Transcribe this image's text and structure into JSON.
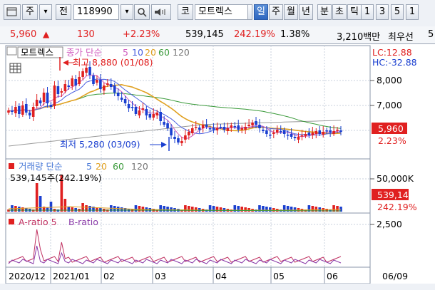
{
  "toolbar": {
    "market_button": "주",
    "dropdown_arrow": "▾",
    "prev_button": "전",
    "stock_code": "118990",
    "code_button": "코",
    "stock_name": "모트렉스",
    "period_buttons": [
      "일",
      "주",
      "월",
      "년",
      "분",
      "초",
      "틱"
    ],
    "selected_period": "일",
    "interval_buttons": [
      "1",
      "3",
      "5",
      "1"
    ],
    "icons": [
      "chart-menu-icon",
      "search-icon",
      "speaker-icon"
    ]
  },
  "quote": {
    "price": "5,960",
    "change_arrow": "▲",
    "change": "130",
    "change_pct": "+2.23%",
    "volume": "539,145",
    "volume_ratio": "242.19%",
    "turnover_rate": "1.38%",
    "amount": "3,210백만",
    "preferred_label": "최우선",
    "partial": "5"
  },
  "price_panel": {
    "legend_name": "모트렉스",
    "legend_ma": "종가 단순",
    "ma_periods": [
      "5",
      "10",
      "20",
      "60",
      "120"
    ],
    "ma_colors": [
      "#d05ec0",
      "#4a5fe0",
      "#e0a020",
      "#3a9a3a",
      "#9a9a9a"
    ],
    "high_label": "최고 8,880 (01/08)",
    "low_label": "최저 5,280 (03/09)",
    "lc_label": "LC:12.88",
    "hc_label": "HC:-32.88",
    "price_ticks": [
      "8,000",
      "7,000",
      "6,000"
    ],
    "current_price": "5,960",
    "current_pct": "2.23%"
  },
  "volume_panel": {
    "legend": "거래량 단순",
    "ma_periods": [
      "5",
      "20",
      "60",
      "120"
    ],
    "value_label": "539,145주(242.19%)",
    "tick": "50,000K",
    "current_volume": "539,145",
    "current_pct": "242.19%"
  },
  "ratio_panel": {
    "a_label": "A-ratio 5",
    "b_label": "B-ratio",
    "tick": "2,500"
  },
  "x_axis": {
    "labels": [
      "2020/12",
      "2021/01",
      "02",
      "03",
      "04",
      "05",
      "06",
      "06/09"
    ]
  },
  "colors": {
    "up": "#e02020",
    "down": "#1a3fd0",
    "accent": "#2f67c0",
    "grid": "#b8c2d4"
  }
}
